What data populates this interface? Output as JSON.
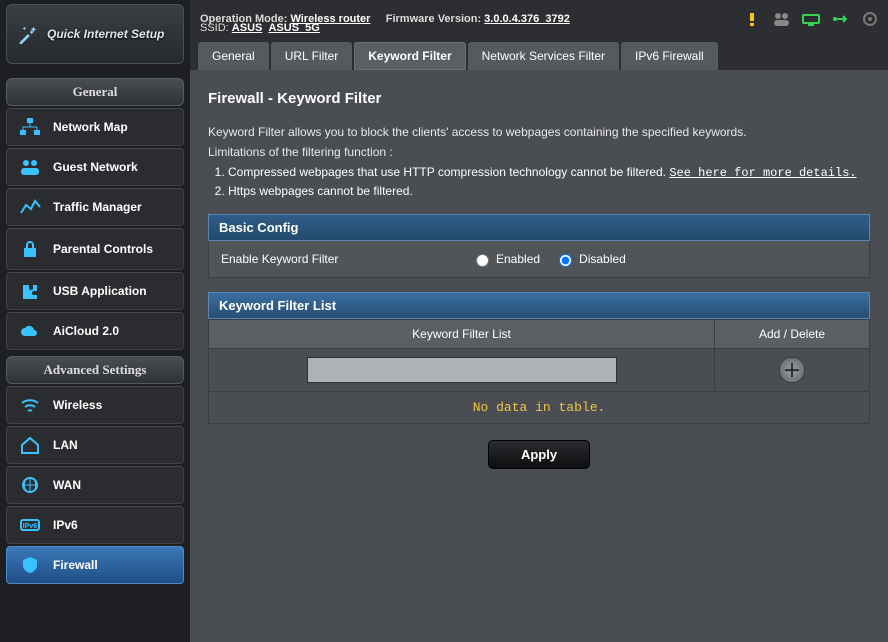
{
  "qis_label": "Quick Internet Setup",
  "sidebar": {
    "general_hdr": "General",
    "general_items": [
      {
        "label": "Network Map",
        "icon": "network-map"
      },
      {
        "label": "Guest Network",
        "icon": "guests"
      },
      {
        "label": "Traffic Manager",
        "icon": "traffic"
      },
      {
        "label": "Parental Controls",
        "icon": "lock"
      },
      {
        "label": "USB Application",
        "icon": "puzzle"
      },
      {
        "label": "AiCloud 2.0",
        "icon": "cloud"
      }
    ],
    "advanced_hdr": "Advanced Settings",
    "advanced_items": [
      {
        "label": "Wireless",
        "icon": "wifi",
        "active": false
      },
      {
        "label": "LAN",
        "icon": "home",
        "active": false
      },
      {
        "label": "WAN",
        "icon": "globe",
        "active": false
      },
      {
        "label": "IPv6",
        "icon": "ipv6",
        "active": false
      },
      {
        "label": "Firewall",
        "icon": "shield",
        "active": true
      }
    ]
  },
  "topbar": {
    "op_label": "Operation Mode:",
    "op_value": "Wireless router",
    "fw_label": "Firmware Version:",
    "fw_value": "3.0.0.4.376_3792",
    "ssid_label": "SSID:",
    "ssid1": "ASUS",
    "ssid2": "ASUS_5G"
  },
  "tabs": [
    {
      "label": "General",
      "active": false
    },
    {
      "label": "URL Filter",
      "active": false
    },
    {
      "label": "Keyword Filter",
      "active": true
    },
    {
      "label": "Network Services Filter",
      "active": false
    },
    {
      "label": "IPv6 Firewall",
      "active": false
    }
  ],
  "page": {
    "title": "Firewall - Keyword Filter",
    "desc": "Keyword Filter allows you to block the clients' access to webpages containing the specified keywords.",
    "lims_intro": "Limitations of the filtering function :",
    "lim1": "Compressed webpages that use HTTP compression technology cannot be filtered. ",
    "lim1_link": "See here for more details.",
    "lim2": "Https webpages cannot be filtered.",
    "basic_hdr": "Basic Config",
    "enable_label": "Enable Keyword Filter",
    "enabled_label": "Enabled",
    "disabled_label": "Disabled",
    "enable_value": "disabled",
    "list_hdr": "Keyword Filter List",
    "col1": "Keyword Filter List",
    "col2": "Add / Delete",
    "nodata": "No data in table.",
    "apply": "Apply"
  }
}
